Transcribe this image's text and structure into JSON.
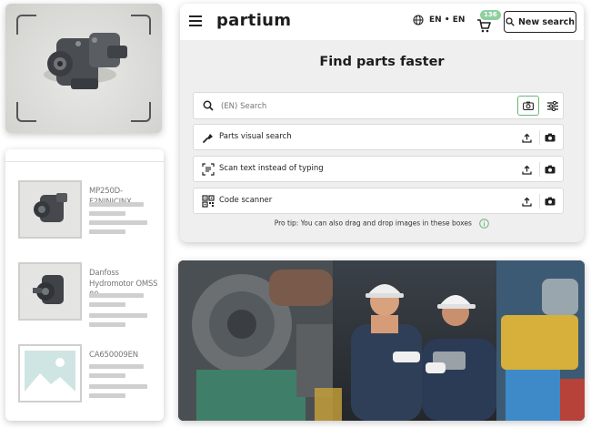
{
  "header": {
    "logo": "partium",
    "language": "EN • EN",
    "cart_count": "136",
    "new_search_label": "New search"
  },
  "main": {
    "title": "Find parts faster",
    "search": {
      "placeholder": "(EN) Search"
    },
    "options": [
      {
        "label": "Parts visual search",
        "icon": "visual-search-icon"
      },
      {
        "label": "Scan text instead of typing",
        "icon": "text-scan-icon"
      },
      {
        "label": "Code scanner",
        "icon": "qr-code-icon"
      }
    ],
    "tip": "Pro tip: You can also drag and drop images in these boxes"
  },
  "results": [
    {
      "label": "MP250D-F2NINICINX"
    },
    {
      "label": "Danfoss Hydromotor OMSS 80"
    },
    {
      "label": "CA650009EN"
    }
  ],
  "colors": {
    "accent_green": "#6ab57a",
    "badge_green": "#8fd0a0",
    "panel_bg": "#efefef"
  }
}
